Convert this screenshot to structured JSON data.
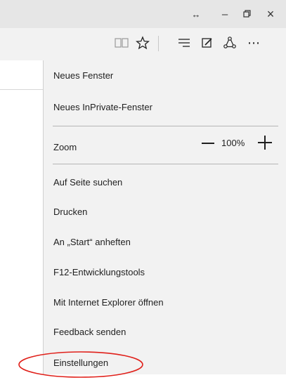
{
  "titlebar": {
    "resize_glyph": "↔",
    "minimize_glyph": "–",
    "restore_glyph": "🗗",
    "close_glyph": "×"
  },
  "toolbar": {
    "icons": [
      "reading-view-icon",
      "favorites-star-icon",
      "hub-icon",
      "web-note-icon",
      "share-icon",
      "more-icon"
    ],
    "more_glyph": "⋯",
    "star_glyph": "☆"
  },
  "menu": {
    "new_window": "Neues Fenster",
    "new_inprivate": "Neues InPrivate-Fenster",
    "zoom_label": "Zoom",
    "zoom_value": "100%",
    "find_on_page": "Auf Seite suchen",
    "print": "Drucken",
    "pin_start": "An „Start“ anheften",
    "devtools": "F12-Entwicklungstools",
    "open_ie": "Mit Internet Explorer öffnen",
    "feedback": "Feedback senden",
    "settings": "Einstellungen"
  },
  "annotation": {
    "highlight_color": "#e0201a",
    "highlighted_item": "settings"
  }
}
